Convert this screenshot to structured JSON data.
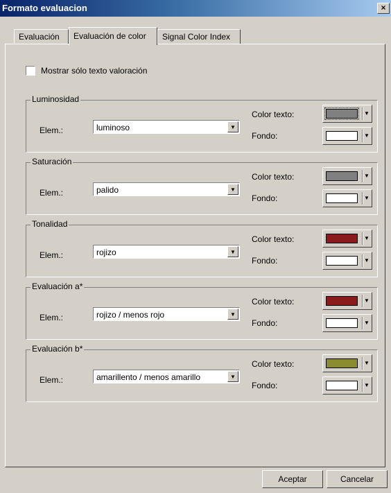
{
  "window": {
    "title": "Formato evaluacion",
    "close_glyph": "×"
  },
  "tabs": [
    {
      "label": "Evaluación",
      "active": false
    },
    {
      "label": "Evaluación de color",
      "active": true
    },
    {
      "label": "Signal Color Index",
      "active": false
    }
  ],
  "option": {
    "label": "Mostrar sólo texto valoración",
    "checked": false
  },
  "common": {
    "elem_label": "Elem.:",
    "color_text_label": "Color texto:",
    "background_label": "Fondo:",
    "dropdown_glyph": "▼"
  },
  "groups": [
    {
      "title": "Luminosidad",
      "value": "luminoso",
      "text_color": "#808080",
      "background_color": "#ffffff"
    },
    {
      "title": "Saturación",
      "value": "palido",
      "text_color": "#808080",
      "background_color": "#ffffff"
    },
    {
      "title": "Tonalidad",
      "value": "rojizo",
      "text_color": "#8b1a1a",
      "background_color": "#ffffff"
    },
    {
      "title": "Evaluación a*",
      "value": "rojizo / menos rojo",
      "text_color": "#8b1a1a",
      "background_color": "#ffffff"
    },
    {
      "title": "Evaluación b*",
      "value": "amarillento / menos amarillo",
      "text_color": "#8b8b32",
      "background_color": "#ffffff"
    }
  ],
  "buttons": {
    "ok": "Aceptar",
    "cancel": "Cancelar"
  }
}
